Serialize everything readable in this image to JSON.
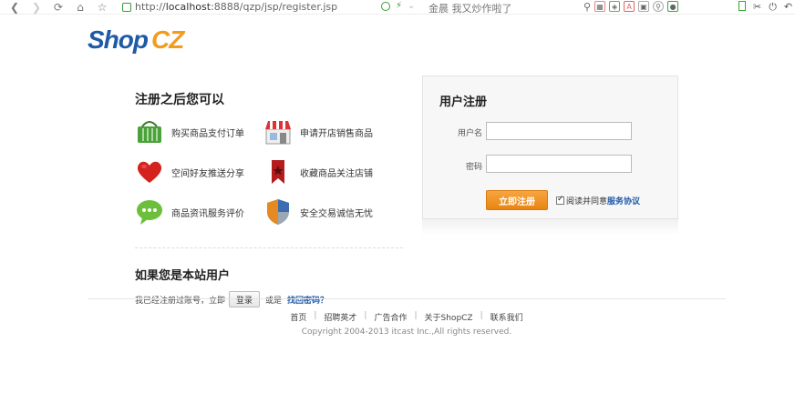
{
  "browser": {
    "url_prefix": "http://",
    "url_host": "localhost",
    "url_rest": ":8888/qzp/jsp/register.jsp",
    "news": "金晨 我又炒作啦了"
  },
  "logo": {
    "shop": "Shop",
    "cz": "CZ"
  },
  "left": {
    "title": "注册之后您可以",
    "features": [
      {
        "label": "购买商品支付订单",
        "icon": "basket-icon"
      },
      {
        "label": "申请开店销售商品",
        "icon": "store-icon"
      },
      {
        "label": "空间好友推送分享",
        "icon": "heart-icon"
      },
      {
        "label": "收藏商品关注店铺",
        "icon": "bookmark-icon"
      },
      {
        "label": "商品资讯服务评价",
        "icon": "chat-icon"
      },
      {
        "label": "安全交易诚信无忧",
        "icon": "shield-icon"
      }
    ],
    "member_title": "如果您是本站用户",
    "member_text": "我已经注册过账号，立即",
    "login_btn": "登录",
    "or_text": "或是",
    "forget_link": "找回密码？"
  },
  "register": {
    "title": "用户注册",
    "username_label": "用户名",
    "password_label": "密码",
    "username_value": "",
    "password_value": "",
    "submit": "立即注册",
    "agree_text": "阅读并同意",
    "agree_link": "服务协议",
    "agree_checked": true
  },
  "footer": {
    "links": [
      "首页",
      "招聘英才",
      "广告合作",
      "关于ShopCZ",
      "联系我们"
    ],
    "copyright": "Copyright 2004-2013 itcast Inc.,All rights reserved."
  },
  "colors": {
    "brand_blue": "#1f5aa6",
    "brand_orange": "#f29c1f",
    "button_orange": "#e88512"
  }
}
